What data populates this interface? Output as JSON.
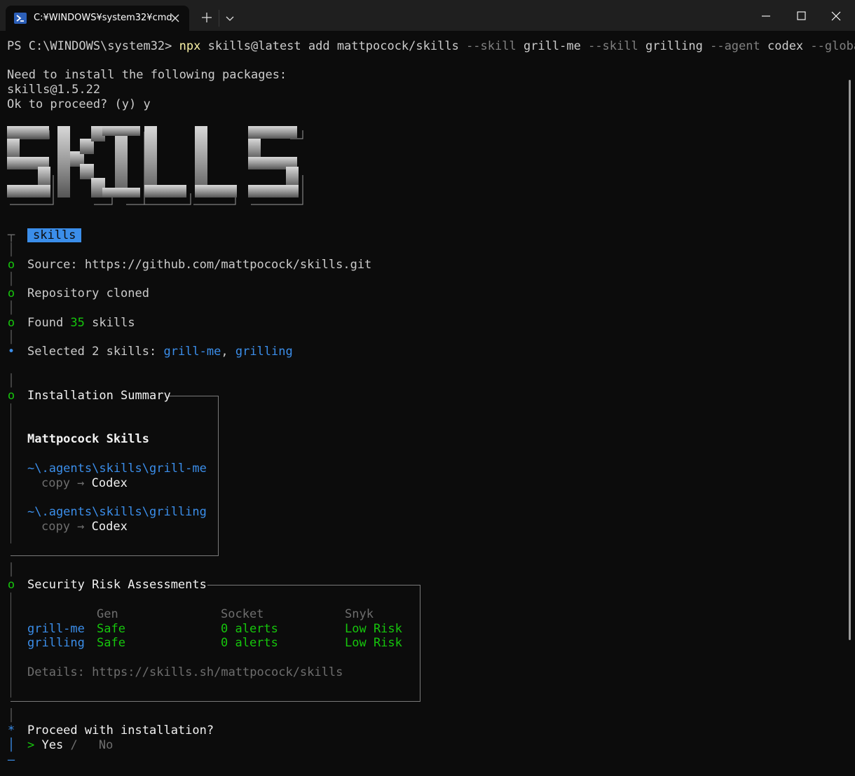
{
  "window": {
    "tab_title": "C:¥WINDOWS¥system32¥cmd",
    "tab_icon": "powershell-icon"
  },
  "terminal": {
    "prompt": "PS C:\\WINDOWS\\system32> ",
    "cmd_npx": "npx",
    "cmd_pkg": " skills@latest add mattpocock/skills ",
    "flag_skill": "--skill",
    "val_grill_me": " grill-me ",
    "flag_skill2": "--skill",
    "val_grilling": " grilling ",
    "flag_agent": "--agent",
    "val_codex": " codex ",
    "flag_global": "--global",
    "need_install": "Need to install the following packages:",
    "package": "skills@1.5.22",
    "ok_proceed": "Ok to proceed? (y) y",
    "banner": "SKILLS",
    "badge": "skills",
    "source_label": "Source: ",
    "source_url": "https://github.com/mattpocock/skills.git",
    "repo_cloned": "Repository cloned",
    "found_label": "Found ",
    "found_count": "35",
    "found_suffix": " skills",
    "selected_label": "Selected 2 skills: ",
    "selected_1": "grill-me",
    "selected_sep": ", ",
    "selected_2": "grilling",
    "summary_title": "Installation Summary",
    "summary_heading": "Mattpocock Skills",
    "path_1": "~\\.agents\\skills\\grill-me",
    "path_2": "~\\.agents\\skills\\grilling",
    "copy_label": "copy → ",
    "copy_target": "Codex",
    "security_title": "Security Risk Assessments",
    "col_gen": "Gen",
    "col_socket": "Socket",
    "col_snyk": "Snyk",
    "rows": [
      {
        "name": "grill-me",
        "gen": "Safe",
        "socket": "0 alerts",
        "snyk": "Low Risk"
      },
      {
        "name": "grilling",
        "gen": "Safe",
        "socket": "0 alerts",
        "snyk": "Low Risk"
      }
    ],
    "details": "Details: https://skills.sh/mattpocock/skills",
    "proceed_question": "Proceed with installation?",
    "yes": "Yes",
    "slash": " / ",
    "no": "No"
  },
  "colors": {
    "background": "#0c0c0c",
    "accent_blue": "#3b8eea",
    "ok_green": "#16c60c",
    "command_yellow": "#f9f1a5"
  }
}
